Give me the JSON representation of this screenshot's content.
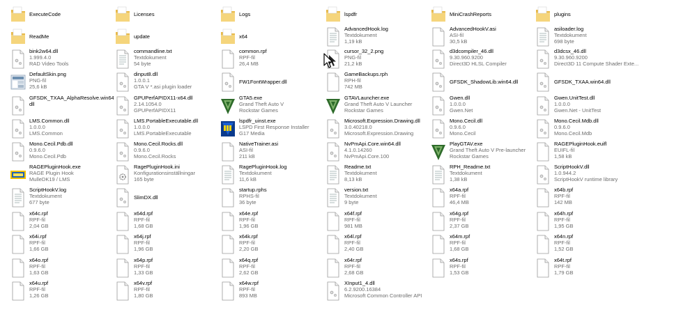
{
  "items": [
    {
      "name": "ExecuteCode",
      "icon": "folder-icon"
    },
    {
      "name": "Licenses",
      "icon": "folder-icon"
    },
    {
      "name": "Logs",
      "icon": "folder-icon"
    },
    {
      "name": "lspdfr",
      "icon": "folder-icon"
    },
    {
      "name": "MiniCrashReports",
      "icon": "folder-icon"
    },
    {
      "name": "plugins",
      "icon": "folder-icon"
    },
    {
      "name": "ReadMe",
      "icon": "folder-icon"
    },
    {
      "name": "update",
      "icon": "folder-icon"
    },
    {
      "name": "x64",
      "icon": "folder-icon"
    },
    {
      "name": "AdvancedHook.log",
      "icon": "text-file-icon",
      "l1": "Textdokument",
      "l2": "1,19 kB"
    },
    {
      "name": "AdvancedHookV.asi",
      "icon": "file-icon",
      "l1": "ASI-fil",
      "l2": "30,5 kB"
    },
    {
      "name": "asiloader.log",
      "icon": "text-file-icon",
      "l1": "Textdokument",
      "l2": "698 byte"
    },
    {
      "name": "bink2w64.dll",
      "icon": "dll-icon",
      "l1": "1.999.4.0",
      "l2": "RAD Video Tools"
    },
    {
      "name": "commandline.txt",
      "icon": "text-file-icon",
      "l1": "Textdokument",
      "l2": "54 byte"
    },
    {
      "name": "common.rpf",
      "icon": "file-icon",
      "l1": "RPF-fil",
      "l2": "26,4 MB"
    },
    {
      "name": "cursor_32_2.png",
      "icon": "image-file-icon",
      "l1": "PNG-fil",
      "l2": "21,2 kB"
    },
    {
      "name": "d3dcompiler_46.dll",
      "icon": "dll-icon",
      "l1": "9.30.960.9200",
      "l2": "Direct3D HLSL Compiler"
    },
    {
      "name": "d3dcsx_46.dll",
      "icon": "dll-icon",
      "l1": "9.30.960.9200",
      "l2": "Direct3D 11 Compute Shader Exte..."
    },
    {
      "name": "DefaultSkin.png",
      "icon": "skin-image-icon",
      "l1": "PNG-fil",
      "l2": "25,6 kB"
    },
    {
      "name": "dinput8.dll",
      "icon": "dll-icon",
      "l1": "1.0.0.1",
      "l2": "GTA V *.asi plugin loader"
    },
    {
      "name": "FW1FontWrapper.dll",
      "icon": "dll-icon"
    },
    {
      "name": "GameBackups.rph",
      "icon": "file-icon",
      "l1": "RPH-fil",
      "l2": "742 MB"
    },
    {
      "name": "GFSDK_ShadowLib.win64.dll",
      "icon": "dll-icon"
    },
    {
      "name": "GFSDK_TXAA.win64.dll",
      "icon": "dll-icon"
    },
    {
      "name": "GFSDK_TXAA_AlphaResolve.win64.",
      "name2": "dll",
      "icon": "dll-icon"
    },
    {
      "name": "GPUPerfAPIDX11-x64.dll",
      "icon": "dll-icon",
      "l1": "2.14.1054.0",
      "l2": "GPUPerfAPIDX11"
    },
    {
      "name": "GTA5.exe",
      "icon": "gta-v-logo-icon",
      "l1": "Grand Theft Auto V",
      "l2": "Rockstar Games"
    },
    {
      "name": "GTAVLauncher.exe",
      "icon": "gta-v-logo-icon",
      "l1": "Grand Theft Auto V Launcher",
      "l2": "Rockstar Games"
    },
    {
      "name": "Gwen.dll",
      "icon": "dll-icon",
      "l1": "1.0.0.0",
      "l2": "Gwen.Net"
    },
    {
      "name": "Gwen.UnitTest.dll",
      "icon": "dll-icon",
      "l1": "1.0.0.0",
      "l2": "Gwen.Net - UnitTest"
    },
    {
      "name": "LMS.Common.dll",
      "icon": "dll-icon",
      "l1": "1.0.0.0",
      "l2": "LMS.Common"
    },
    {
      "name": "LMS.PortableExecutable.dll",
      "icon": "dll-icon",
      "l1": "1.0.0.0",
      "l2": "LMS.PortableExecutable"
    },
    {
      "name": "lspdfr_uinst.exe",
      "icon": "lspdfr-logo-icon",
      "l1": "LSPD First Response Installer",
      "l2": "G17 Media"
    },
    {
      "name": "Microsoft.Expression.Drawing.dll",
      "icon": "dll-icon",
      "l1": "3.0.40218.0",
      "l2": "Microsoft.Expression.Drawing"
    },
    {
      "name": "Mono.Cecil.dll",
      "icon": "dll-icon",
      "l1": "0.9.6.0",
      "l2": "Mono.Cecil"
    },
    {
      "name": "Mono.Cecil.Mdb.dll",
      "icon": "dll-icon",
      "l1": "0.9.6.0",
      "l2": "Mono.Cecil.Mdb"
    },
    {
      "name": "Mono.Cecil.Pdb.dll",
      "icon": "dll-icon",
      "l1": "0.9.6.0",
      "l2": "Mono.Cecil.Pdb"
    },
    {
      "name": "Mono.Cecil.Rocks.dll",
      "icon": "dll-icon",
      "l1": "0.9.6.0",
      "l2": "Mono.Cecil.Rocks"
    },
    {
      "name": "NativeTrainer.asi",
      "icon": "file-icon",
      "l1": "ASI-fil",
      "l2": "211 kB"
    },
    {
      "name": "NvPmApi.Core.win64.dll",
      "icon": "dll-icon",
      "l1": "4.1.0.14260",
      "l2": "NvPmApi.Core.100"
    },
    {
      "name": "PlayGTAV.exe",
      "icon": "gta-v-logo-icon",
      "l1": "Grand Theft Auto V Pre-launcher",
      "l2": "Rockstar Games"
    },
    {
      "name": "RAGEPluginHook.euifl",
      "icon": "file-icon",
      "l1": "EUIFL-fil",
      "l2": "1,58 kB"
    },
    {
      "name": "RAGEPluginHook.exe",
      "icon": "rage-logo-icon",
      "l1": "RAGE Plugin Hook",
      "l2": "MulleDK19 / LMS"
    },
    {
      "name": "RagePluginHook.ini",
      "icon": "settings-file-icon",
      "l1": "Konfigurationsinställningar",
      "l2": "165 byte"
    },
    {
      "name": "RagePluginHook.log",
      "icon": "text-file-icon",
      "l1": "Textdokument",
      "l2": "11,6 kB"
    },
    {
      "name": "Readme.txt",
      "icon": "text-file-icon",
      "l1": "Textdokument",
      "l2": "8,13 kB"
    },
    {
      "name": "RPH_Readme.txt",
      "icon": "text-file-icon",
      "l1": "Textdokument",
      "l2": "1,38 kB"
    },
    {
      "name": "ScriptHookV.dll",
      "icon": "dll-icon",
      "l1": "1.0.944.2",
      "l2": "ScriptHookV runtime library"
    },
    {
      "name": "ScriptHookV.log",
      "icon": "text-file-icon",
      "l1": "Textdokument",
      "l2": "677 byte"
    },
    {
      "name": "SlimDX.dll",
      "icon": "dll-icon"
    },
    {
      "name": "startup.rphs",
      "icon": "file-icon",
      "l1": "RPHS-fil",
      "l2": "36 byte"
    },
    {
      "name": "version.txt",
      "icon": "text-file-icon",
      "l1": "Textdokument",
      "l2": "9 byte"
    },
    {
      "name": "x64a.rpf",
      "icon": "file-icon",
      "l1": "RPF-fil",
      "l2": "46,4 MB"
    },
    {
      "name": "x64b.rpf",
      "icon": "file-icon",
      "l1": "RPF-fil",
      "l2": "142 MB"
    },
    {
      "name": "x64c.rpf",
      "icon": "file-icon",
      "l1": "RPF-fil",
      "l2": "2,04 GB"
    },
    {
      "name": "x64d.rpf",
      "icon": "file-icon",
      "l1": "RPF-fil",
      "l2": "1,68 GB"
    },
    {
      "name": "x64e.rpf",
      "icon": "file-icon",
      "l1": "RPF-fil",
      "l2": "1,96 GB"
    },
    {
      "name": "x64f.rpf",
      "icon": "file-icon",
      "l1": "RPF-fil",
      "l2": "981 MB"
    },
    {
      "name": "x64g.rpf",
      "icon": "file-icon",
      "l1": "RPF-fil",
      "l2": "2,37 GB"
    },
    {
      "name": "x64h.rpf",
      "icon": "file-icon",
      "l1": "RPF-fil",
      "l2": "1,95 GB"
    },
    {
      "name": "x64i.rpf",
      "icon": "file-icon",
      "l1": "RPF-fil",
      "l2": "1,66 GB"
    },
    {
      "name": "x64j.rpf",
      "icon": "file-icon",
      "l1": "RPF-fil",
      "l2": "1,96 GB"
    },
    {
      "name": "x64k.rpf",
      "icon": "file-icon",
      "l1": "RPF-fil",
      "l2": "2,20 GB"
    },
    {
      "name": "x64l.rpf",
      "icon": "file-icon",
      "l1": "RPF-fil",
      "l2": "2,40 GB"
    },
    {
      "name": "x64m.rpf",
      "icon": "file-icon",
      "l1": "RPF-fil",
      "l2": "1,68 GB"
    },
    {
      "name": "x64n.rpf",
      "icon": "file-icon",
      "l1": "RPF-fil",
      "l2": "1,52 GB"
    },
    {
      "name": "x64o.rpf",
      "icon": "file-icon",
      "l1": "RPF-fil",
      "l2": "1,63 GB"
    },
    {
      "name": "x64p.rpf",
      "icon": "file-icon",
      "l1": "RPF-fil",
      "l2": "1,33 GB"
    },
    {
      "name": "x64q.rpf",
      "icon": "file-icon",
      "l1": "RPF-fil",
      "l2": "2,62 GB"
    },
    {
      "name": "x64r.rpf",
      "icon": "file-icon",
      "l1": "RPF-fil",
      "l2": "2,68 GB"
    },
    {
      "name": "x64s.rpf",
      "icon": "file-icon",
      "l1": "RPF-fil",
      "l2": "1,53 GB"
    },
    {
      "name": "x64t.rpf",
      "icon": "file-icon",
      "l1": "RPF-fil",
      "l2": "1,79 GB"
    },
    {
      "name": "x64u.rpf",
      "icon": "file-icon",
      "l1": "RPF-fil",
      "l2": "1,26 GB"
    },
    {
      "name": "x64v.rpf",
      "icon": "file-icon",
      "l1": "RPF-fil",
      "l2": "1,80 GB"
    },
    {
      "name": "x64w.rpf",
      "icon": "file-icon",
      "l1": "RPF-fil",
      "l2": "893 MB"
    },
    {
      "name": "XInput1_4.dll",
      "icon": "dll-icon",
      "l1": "6.2.9200.16384",
      "l2": "Microsoft Common Controller API"
    }
  ],
  "colors": {
    "folder": "#e8b94a",
    "folder_light": "#f5d57c",
    "gta_green": "#2e6b2a",
    "rage_yellow": "#f2c200",
    "rage_blue": "#1e63b8",
    "lspdfr_blue": "#0a3a8c"
  }
}
